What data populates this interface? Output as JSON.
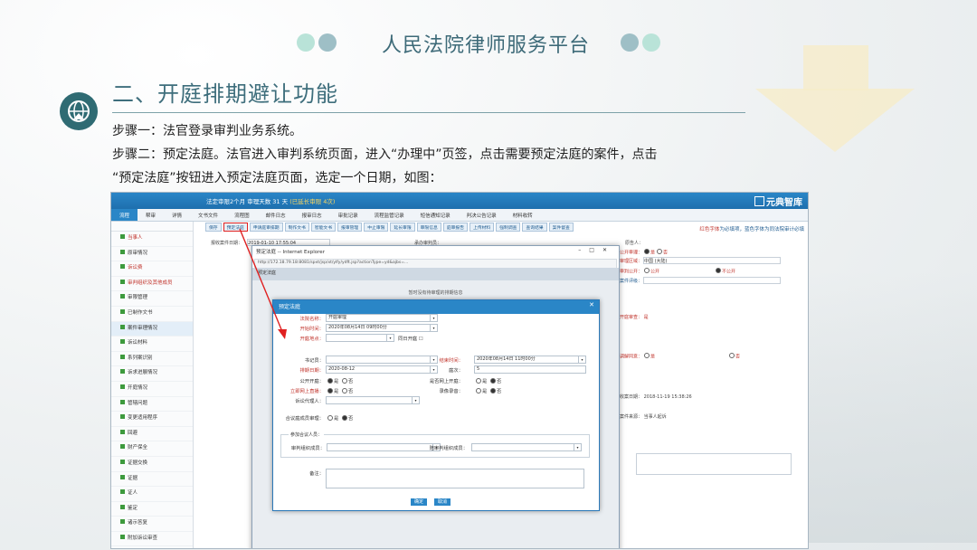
{
  "slide": {
    "title": "人民法院律师服务平台",
    "section_title": "二、开庭排期避让功能",
    "steps": [
      "步骤一：法官登录审判业务系统。",
      "步骤二：预定法庭。法官进入审判系统页面，进入“办理中”页签，点击需要预定法庭的案件，点击",
      "“预定法庭”按钮进入预定法庭页面，选定一个日期，如图："
    ]
  },
  "app": {
    "header_case": "法定审限2个月 审理天数 31 天",
    "header_extra": "(已延长审限 4次)",
    "brand": "元典智库",
    "top_menu": [
      "流程",
      "帮审",
      "详情",
      "文书文件",
      "流程图",
      "邮件日志",
      "报审日志",
      "审批记录",
      "流程监管记录",
      "短信通知记录",
      "判决公告记录",
      "材料收转"
    ],
    "side_items": [
      {
        "label": "当事人",
        "style": "red"
      },
      {
        "label": "原审情况",
        "style": ""
      },
      {
        "label": "诉讼费",
        "style": "red"
      },
      {
        "label": "审判组织及其他成员",
        "style": "red"
      },
      {
        "label": "审限管理",
        "style": ""
      },
      {
        "label": "已制作文书",
        "style": ""
      },
      {
        "label": "案件审理情况",
        "style": "hl"
      },
      {
        "label": "诉讼材料",
        "style": ""
      },
      {
        "label": "系列案识别",
        "style": ""
      },
      {
        "label": "诉求进展情况",
        "style": ""
      },
      {
        "label": "开庭情况",
        "style": ""
      },
      {
        "label": "管辖问题",
        "style": ""
      },
      {
        "label": "变更适用程序",
        "style": ""
      },
      {
        "label": "回避",
        "style": ""
      },
      {
        "label": "财产保全",
        "style": ""
      },
      {
        "label": "证据交换",
        "style": ""
      },
      {
        "label": "证据",
        "style": ""
      },
      {
        "label": "证人",
        "style": ""
      },
      {
        "label": "鉴定",
        "style": ""
      },
      {
        "label": "诸示答复",
        "style": ""
      },
      {
        "label": "附加诉讼审查",
        "style": ""
      },
      {
        "label": "当事人追加/变更",
        "style": ""
      }
    ],
    "toolbar": [
      "保存",
      "预定法庭",
      "申请庭审排期",
      "制作文书",
      "智能文书",
      "报审管理",
      "中止审限",
      "延长审限",
      "审限信息",
      "庭审报告",
      "上传材料",
      "强制调查",
      "查询结果",
      "案件督查"
    ],
    "tip_red": "红色字体",
    "tip_text": "为必填项",
    "tip_blue": "蓝色字体",
    "tip_text2": "为同法院审计必填",
    "bg_fields": {
      "date_label": "报收案件日期：",
      "date_value": "2019-01-10 17:55:04",
      "judge_label": "承办审判员：",
      "party_label": "原告人：",
      "court_label": "公开审理：",
      "court_opt1": "是",
      "court_opt2": "否",
      "region_label": "审理区域：",
      "region_value": "中国 (大陆)",
      "public_label": "审判公开：",
      "public_opt1": "公开",
      "public_opt2": "不公开",
      "eval_label": "案件评级：",
      "open_label": "开庭审查：",
      "open_value": "是",
      "agree_label": "调解同意：",
      "yes": "是",
      "no": "否",
      "date2_label": "收案日期：",
      "date2_value": "2018-11-19 15:38:26",
      "src_label": "案件来源：",
      "src_value": "当事人起诉"
    }
  },
  "ie": {
    "title": "预定法庭 -- Internet Explorer",
    "url": "http://172.18.79.18:8081/spxt/jsp/xt/ylfy/ydft.jsp?actionType=yd&ajbs=...",
    "inner_header": "预定法庭",
    "inner_title": "暂时没有待审理的排期信息"
  },
  "modal": {
    "title": "预定法庭",
    "close": "✕",
    "fields": {
      "court_label": "法院名称：",
      "court_value": "开庭审理",
      "start_label": "开始时间：",
      "start_value": "2020年08月14日 09时00分",
      "room_label": "开庭地点：",
      "room_check": "同日开庭",
      "clerk_label": "书记员：",
      "end_label": "结束时间：",
      "end_value": "2020年08月14日 11时00分",
      "date_label": "排期日期：",
      "date_value": "2020-08-12",
      "seq_label": "庭次：",
      "seq_value": "5",
      "public_label": "公开开庭：",
      "online_label": "是否网上开庭：",
      "live_label": "立即网上直播：",
      "record_label": "录像录音：",
      "yes": "是",
      "no": "否",
      "agent_label": "诉讼代理人：",
      "panel_label": "合议庭成员审理：",
      "fieldset_legend": "参加合议人员：",
      "member_label": "审判组织成员：",
      "member2_label": "陪审判组织成员：",
      "remark_label": "备注："
    },
    "ok_label": "确定",
    "cancel_label": "取消"
  }
}
